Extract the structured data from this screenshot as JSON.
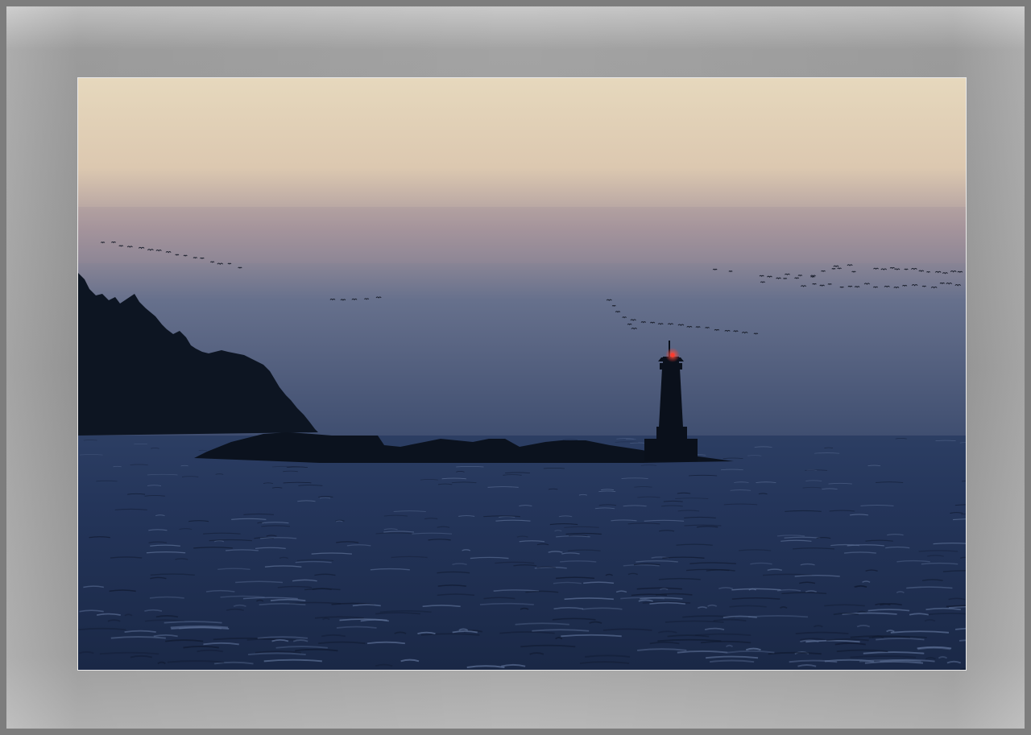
{
  "photo": {
    "subject": "lighthouse-at-dusk",
    "colors": {
      "sky_top": "#e6d8bd",
      "sky_mid": "#b6a4a4",
      "sky_low": "#4f5c7a",
      "horizon": "#3c4a6a",
      "sea": "#24355a",
      "sea_dark": "#16223d",
      "silhouette": "#0d1522",
      "beacon": "#ff3b2f"
    }
  }
}
